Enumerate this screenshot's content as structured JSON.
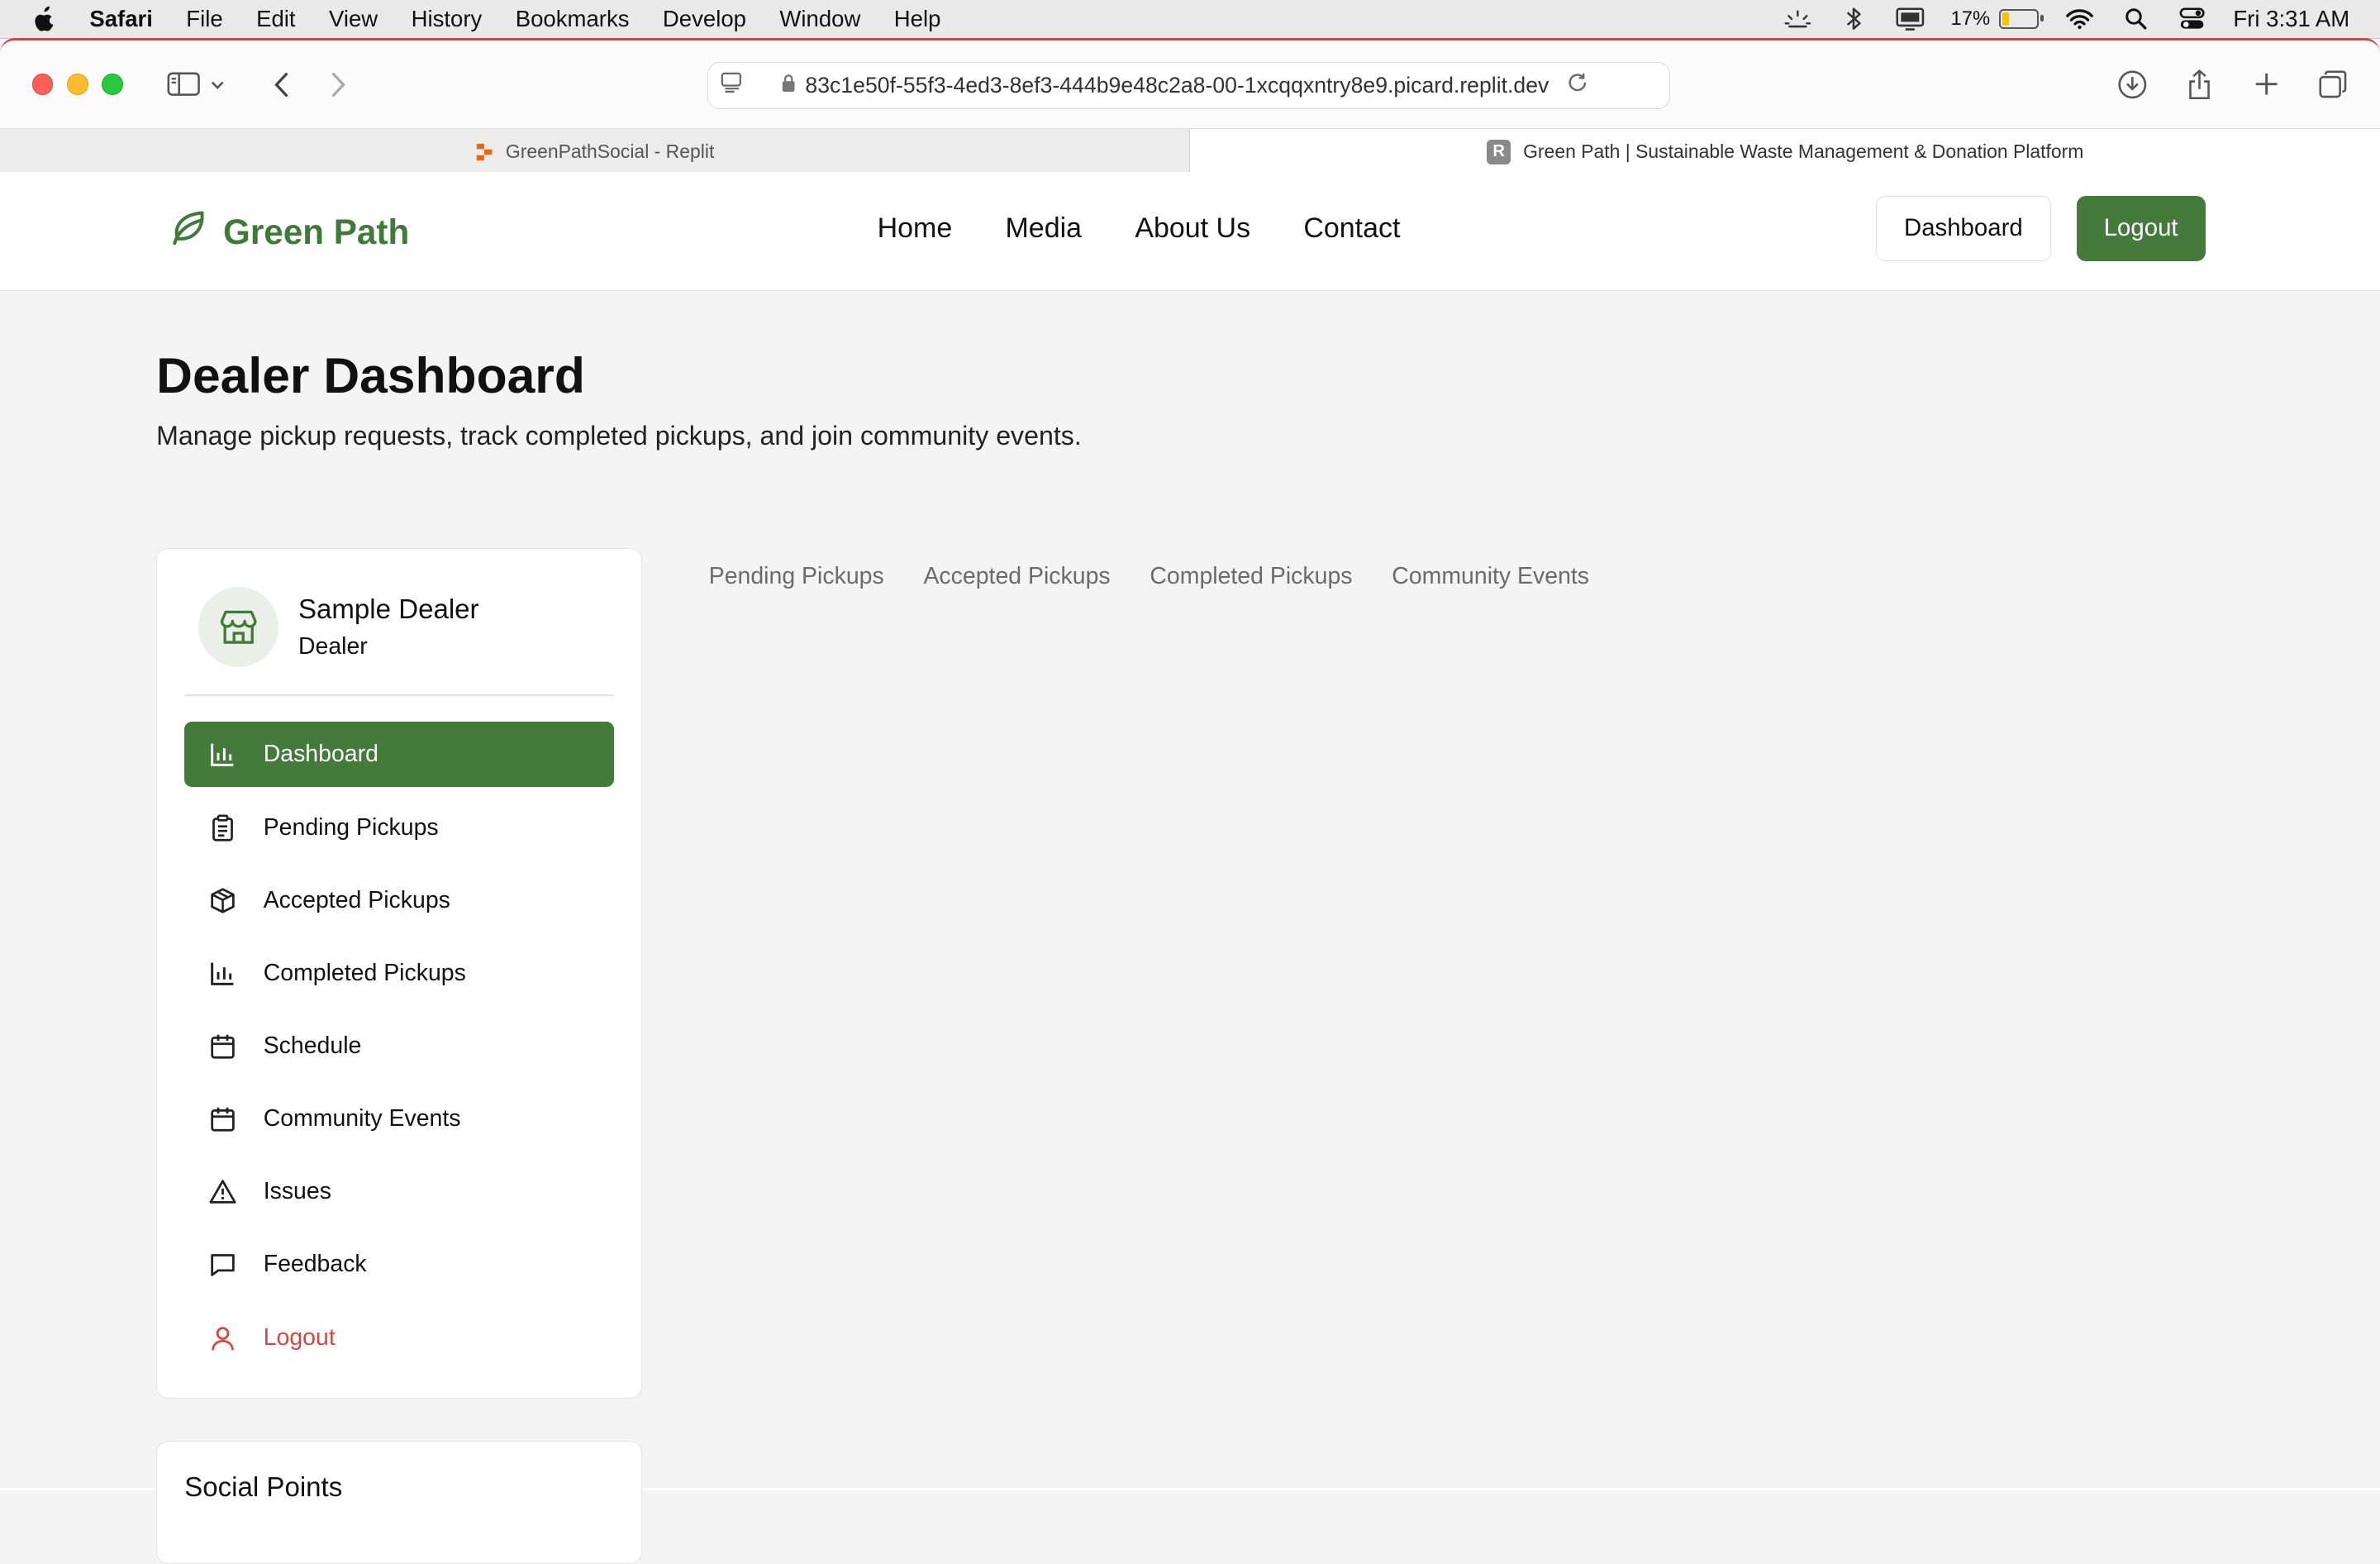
{
  "menubar": {
    "app": "Safari",
    "items": [
      "File",
      "Edit",
      "View",
      "History",
      "Bookmarks",
      "Develop",
      "Window",
      "Help"
    ],
    "battery": "17%",
    "battery_level": 0.17,
    "clock": "Fri 3:31 AM"
  },
  "browser": {
    "url": "83c1e50f-55f3-4ed3-8ef3-444b9e48c2a8-00-1xcqqxntry8e9.picard.replit.dev",
    "tabs": [
      {
        "title": "GreenPathSocial - Replit"
      },
      {
        "title": "Green Path | Sustainable Waste Management & Donation Platform"
      }
    ]
  },
  "site": {
    "brand": "Green Path",
    "brand_color": "#447a3a",
    "nav": [
      "Home",
      "Media",
      "About Us",
      "Contact"
    ],
    "dashboard_button": "Dashboard",
    "logout_button": "Logout"
  },
  "page": {
    "title": "Dealer Dashboard",
    "subtitle": "Manage pickup requests, track completed pickups, and join community events."
  },
  "profile": {
    "name": "Sample Dealer",
    "role": "Dealer"
  },
  "sidebar": {
    "items": [
      {
        "label": "Dashboard",
        "icon": "bar-chart-icon",
        "active": true
      },
      {
        "label": "Pending Pickups",
        "icon": "clipboard-icon"
      },
      {
        "label": "Accepted Pickups",
        "icon": "package-icon"
      },
      {
        "label": "Completed Pickups",
        "icon": "bar-chart-icon"
      },
      {
        "label": "Schedule",
        "icon": "calendar-icon"
      },
      {
        "label": "Community Events",
        "icon": "calendar-icon"
      },
      {
        "label": "Issues",
        "icon": "warning-icon"
      },
      {
        "label": "Feedback",
        "icon": "message-icon"
      },
      {
        "label": "Logout",
        "icon": "user-icon",
        "danger": true
      }
    ]
  },
  "content_tabs": [
    "Pending Pickups",
    "Accepted Pickups",
    "Completed Pickups",
    "Community Events"
  ],
  "social_points": {
    "title": "Social Points"
  }
}
